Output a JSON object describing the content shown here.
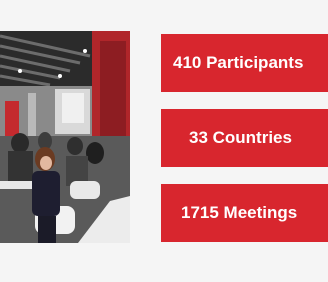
{
  "stats": [
    {
      "label": "410 Participants"
    },
    {
      "label": "33 Countries"
    },
    {
      "label": "1715 Meetings"
    }
  ],
  "colors": {
    "stat_background": "#d8262e",
    "stat_text": "#ffffff",
    "page_background": "#f5f5f5"
  }
}
